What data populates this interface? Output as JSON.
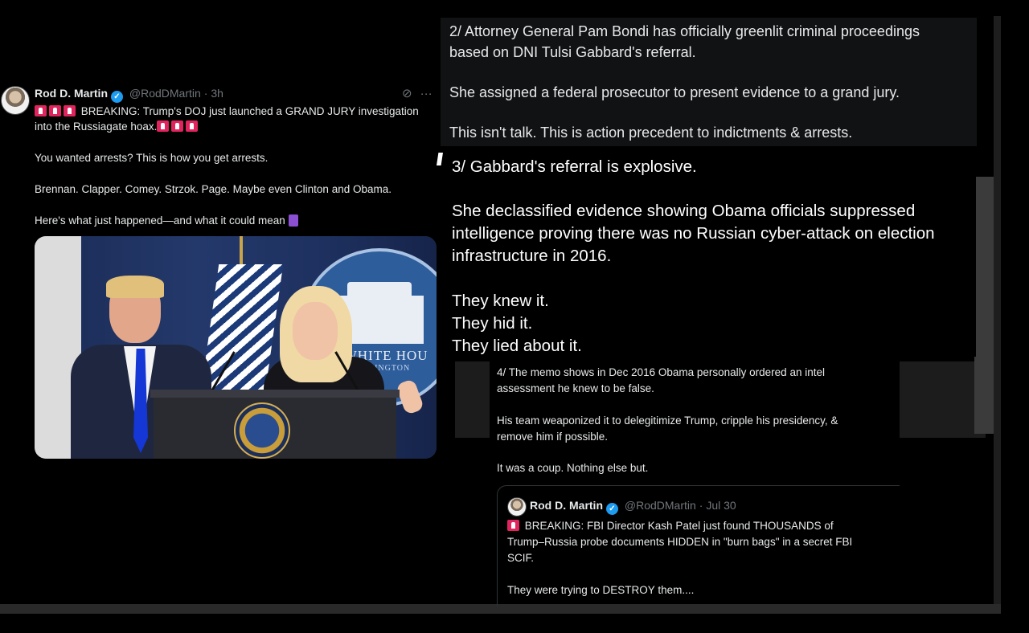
{
  "tweet_main": {
    "author_name": "Rod D. Martin",
    "verified_mark": "✓",
    "handle": "@RodDMartin",
    "time": "· 3h",
    "breaking_text": "BREAKING: Trump's DOJ just launched a GRAND JURY investigation into the Russiagate hoax.",
    "line_arrests": "You wanted arrests? This is how you get arrests.",
    "line_names": "Brennan. Clapper. Comey. Strzok. Page. Maybe even Clinton and Obama.",
    "line_happened": "Here's what just happened—and what it could mean",
    "photo": {
      "seal_text_1": "E WHITE HOU",
      "seal_text_2": "WASHINGTON"
    },
    "icons": [
      "grok-icon",
      "more-icon"
    ],
    "more_glyph": "···",
    "grok_glyph": "⊘"
  },
  "tweet_2": {
    "line1": "2/ Attorney General Pam Bondi has officially greenlit criminal proceedings",
    "line2": "based on DNI Tulsi Gabbard's referral.",
    "line3": "She assigned a federal prosecutor to present evidence to a grand jury.",
    "line4": "This isn't talk. This is action precedent to indictments & arrests."
  },
  "tweet_3": {
    "line1": "3/ Gabbard's referral is explosive.",
    "line2": "She declassified evidence showing Obama officials suppressed",
    "line3": "intelligence proving there was no Russian cyber-attack on election",
    "line4": "infrastructure in 2016.",
    "line5": "They knew it.",
    "line6": "They hid it.",
    "line7": "They lied about it."
  },
  "tweet_4": {
    "line1": "4/ The memo shows in Dec 2016 Obama personally ordered an intel",
    "line2": "assessment he knew to be false.",
    "line3": "His team weaponized it to delegitimize Trump, cripple his presidency, &",
    "line4": "remove him if possible.",
    "line5": "It was a coup. Nothing else but.",
    "quote": {
      "author_name": "Rod D. Martin",
      "handle": "@RodDMartin",
      "time": "· Jul 30",
      "line1": "BREAKING: FBI Director Kash Patel just found THOUSANDS of",
      "line2": "Trump–Russia probe documents HIDDEN in \"burn bags\" in a secret FBI",
      "line3": "SCIF.",
      "line4": "They were trying to DESTROY them...."
    }
  },
  "colors": {
    "background": "#000000",
    "text": "#e7e9ea",
    "muted": "#71767b",
    "verified": "#1d9bf0",
    "siren": "#e0245e"
  }
}
